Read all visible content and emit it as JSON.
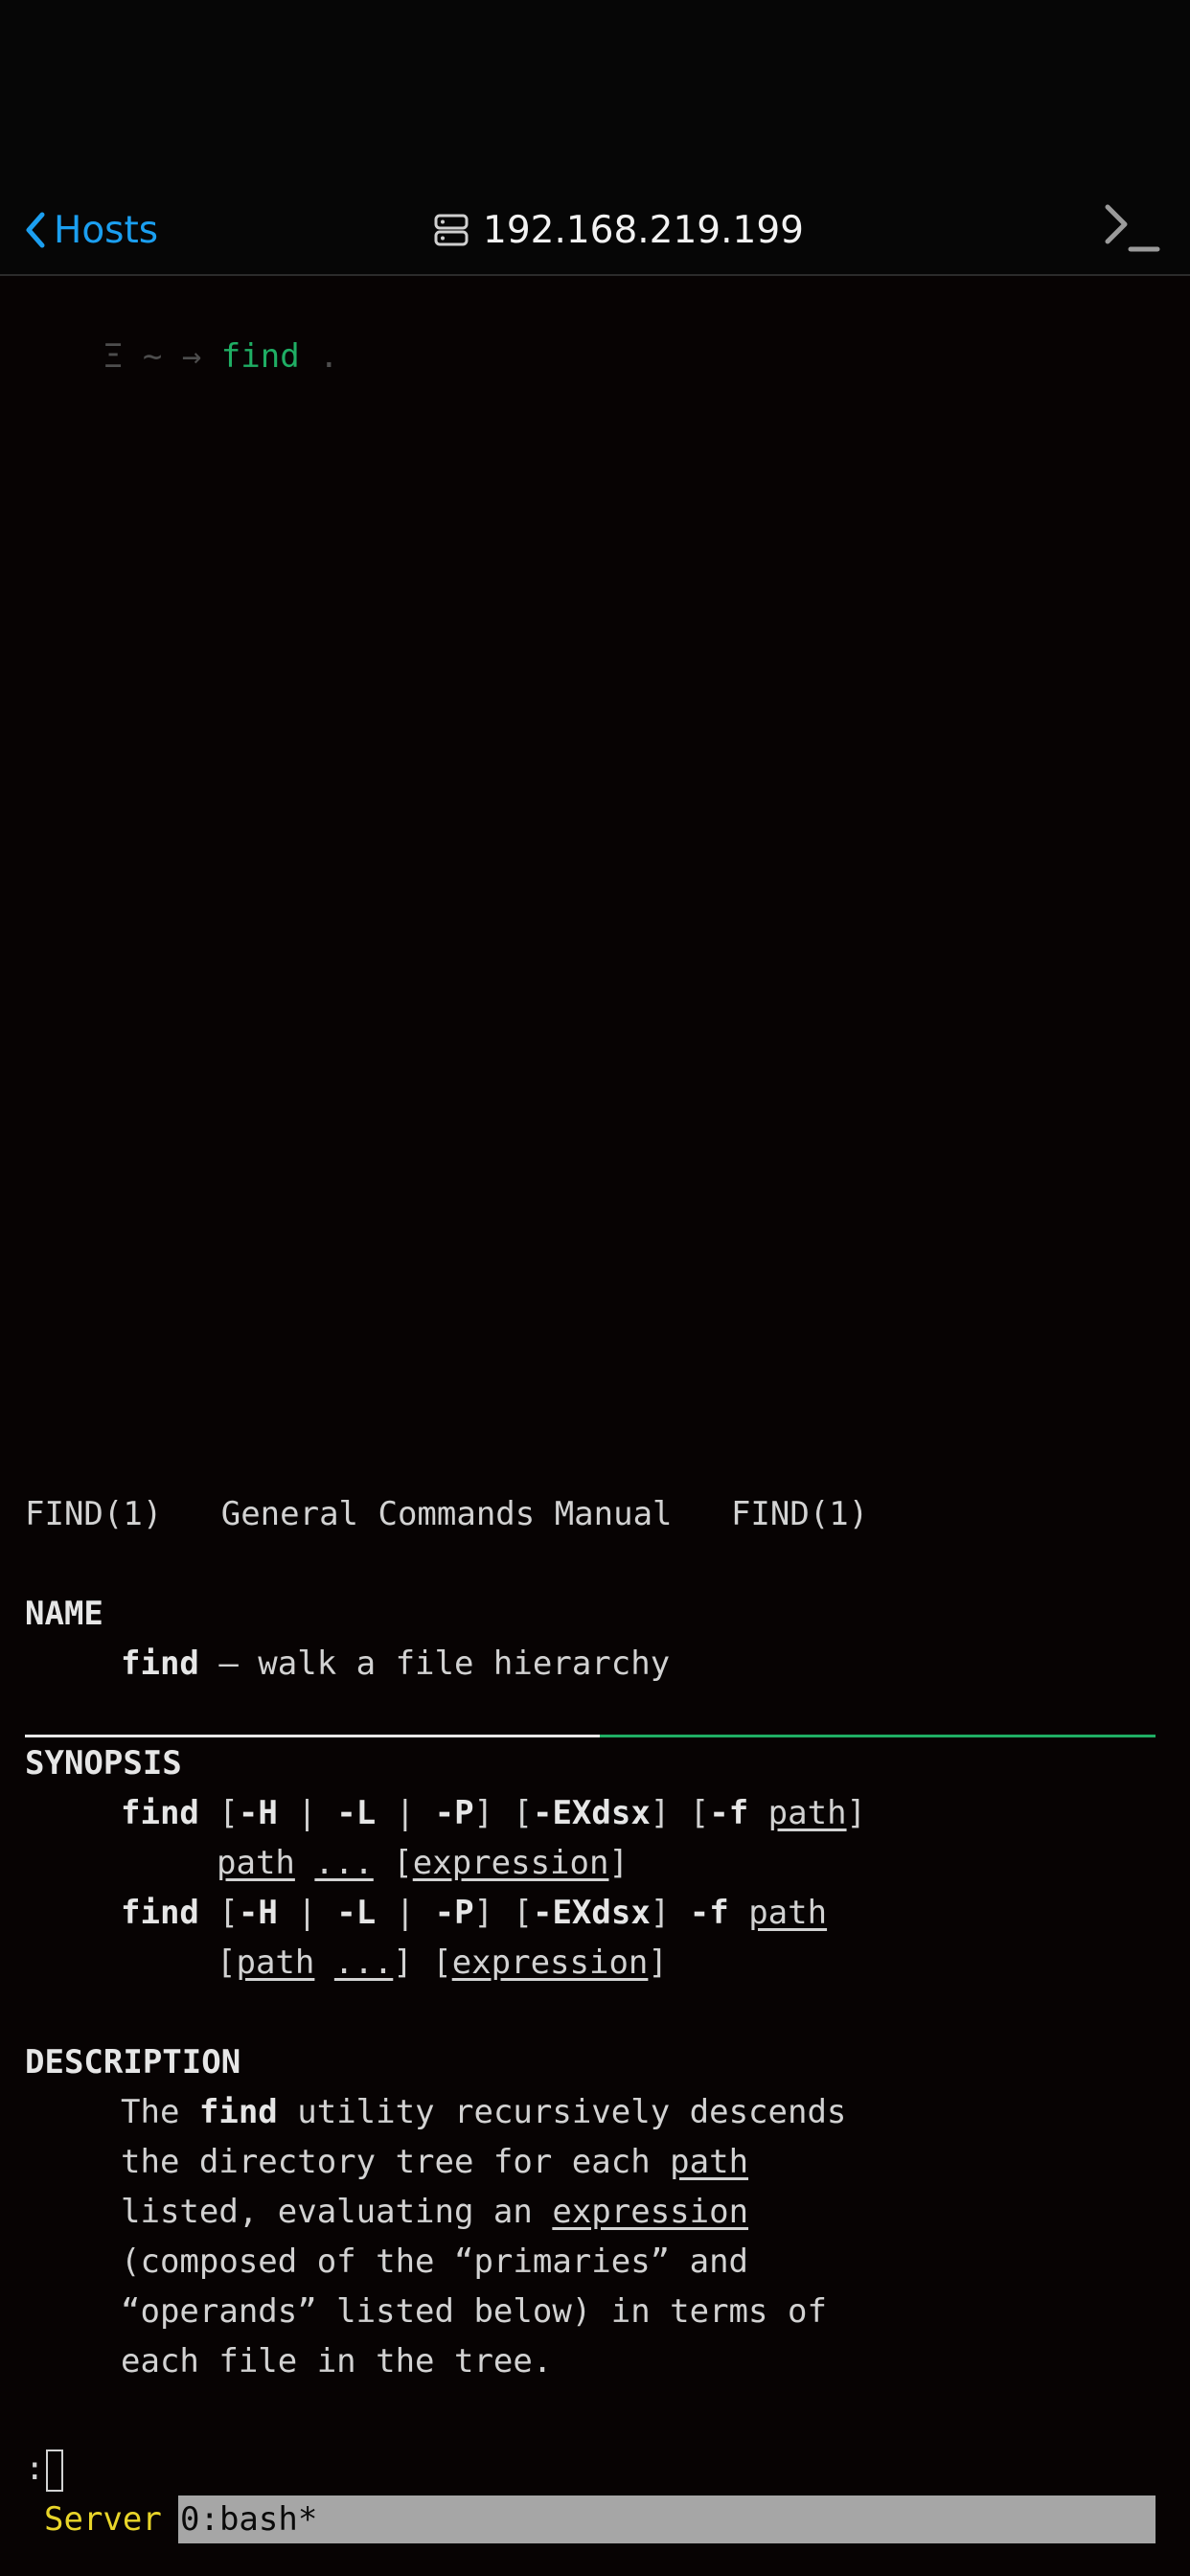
{
  "navbar": {
    "back_label": "Hosts",
    "title": "192.168.219.199",
    "back_icon": "chevron-left-icon",
    "title_icon": "server-icon",
    "action_icon": "terminal-icon"
  },
  "prompt": {
    "symbol": "Ξ",
    "cwd": "~",
    "arrow": "→",
    "command": "find",
    "arg": "."
  },
  "man": {
    "header": {
      "left": "FIND(1)",
      "center": "General Commands Manual",
      "right": "FIND(1)"
    },
    "name_heading": "NAME",
    "name_cmd": "find",
    "name_desc": " – walk a file hierarchy",
    "synopsis_heading": "SYNOPSIS",
    "syn": {
      "cmd": "find",
      "H": "-H",
      "L": "-L",
      "P": "-P",
      "flags": "-EXdsx",
      "f": "-f",
      "path": "path",
      "ellipsis": "...",
      "expression": "expression"
    },
    "description_heading": "DESCRIPTION",
    "desc": {
      "l1_pre": "The ",
      "l1_bold": "find",
      "l1_post": " utility recursively descends",
      "l2_pre": "the directory tree for each ",
      "l2_u": "path",
      "l3_pre": "listed, evaluating an ",
      "l3_u": "expression",
      "l4": "(composed of the “primaries” and",
      "l5": "“operands” listed below) in terms of",
      "l6": "each file in the tree."
    }
  },
  "pager_prompt": ":",
  "statusbar": {
    "session": "Server",
    "window": "0:bash*"
  },
  "colors": {
    "accent": "#1b9ff0",
    "prompt_green": "#1fae64",
    "status_yellow": "#e8d52a",
    "status_gray": "#a6a6a6"
  }
}
